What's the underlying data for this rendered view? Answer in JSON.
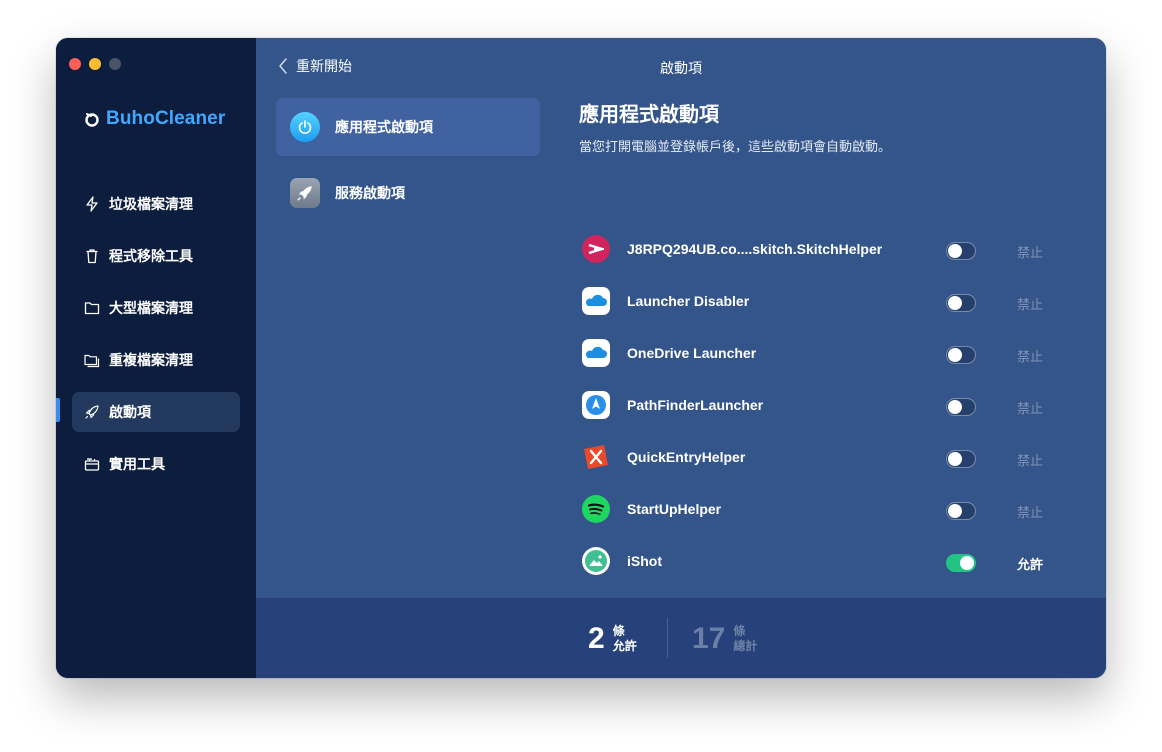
{
  "app": {
    "name": "BuhoCleaner"
  },
  "sidebar": {
    "items": [
      {
        "label": "垃圾檔案清理",
        "icon": "lightning-icon"
      },
      {
        "label": "程式移除工具",
        "icon": "trash-icon"
      },
      {
        "label": "大型檔案清理",
        "icon": "folder-icon"
      },
      {
        "label": "重複檔案清理",
        "icon": "duplicate-folder-icon"
      },
      {
        "label": "啟動項",
        "icon": "rocket-icon",
        "active": true
      },
      {
        "label": "實用工具",
        "icon": "toolbox-icon"
      }
    ]
  },
  "topbar": {
    "back_label": "重新開始",
    "title": "啟動項"
  },
  "subnav": {
    "items": [
      {
        "label": "應用程式啟動項",
        "icon": "power-icon",
        "active": true
      },
      {
        "label": "服務啟動項",
        "icon": "rocket-icon",
        "active": false
      }
    ]
  },
  "main": {
    "title": "應用程式啟動項",
    "description": "當您打開電腦並登錄帳戶後，這些啟動項會自動啟動。"
  },
  "startup_items": [
    {
      "name": "J8RPQ294UB.co....skitch.SkitchHelper",
      "icon": "skitch-icon",
      "enabled": false,
      "status": "禁止"
    },
    {
      "name": "Launcher Disabler",
      "icon": "onedrive-cloud-icon",
      "enabled": false,
      "status": "禁止"
    },
    {
      "name": "OneDrive Launcher",
      "icon": "onedrive-cloud-icon",
      "enabled": false,
      "status": "禁止"
    },
    {
      "name": "PathFinderLauncher",
      "icon": "pathfinder-icon",
      "enabled": false,
      "status": "禁止"
    },
    {
      "name": "QuickEntryHelper",
      "icon": "quickentry-icon",
      "enabled": false,
      "status": "禁止"
    },
    {
      "name": "StartUpHelper",
      "icon": "spotify-icon",
      "enabled": false,
      "status": "禁止"
    },
    {
      "name": "iShot",
      "icon": "ishot-icon",
      "enabled": true,
      "status": "允許"
    }
  ],
  "footer": {
    "allowed_count": "2",
    "allowed_unit": "條",
    "allowed_label": "允許",
    "total_count": "17",
    "total_unit": "條",
    "total_label": "總計"
  },
  "colors": {
    "sidebar_bg": "#0d1d3e",
    "content_bg": "#34558a",
    "brand_blue": "#40a8ff",
    "toggle_on": "#22c383"
  }
}
